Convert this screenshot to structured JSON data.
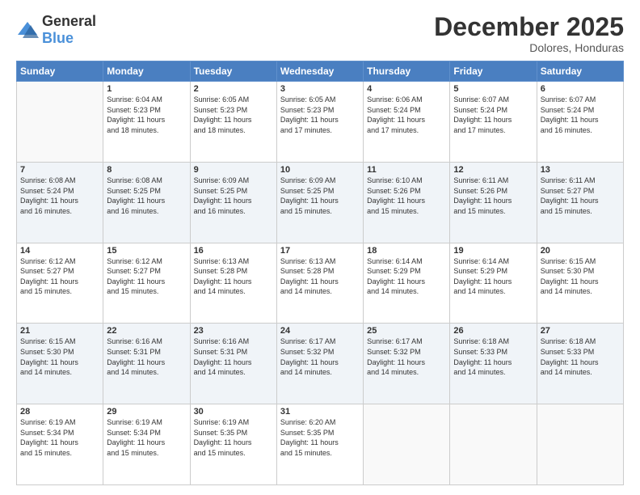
{
  "logo": {
    "general": "General",
    "blue": "Blue"
  },
  "header": {
    "month": "December 2025",
    "location": "Dolores, Honduras"
  },
  "weekdays": [
    "Sunday",
    "Monday",
    "Tuesday",
    "Wednesday",
    "Thursday",
    "Friday",
    "Saturday"
  ],
  "weeks": [
    [
      {
        "day": "",
        "info": ""
      },
      {
        "day": "1",
        "info": "Sunrise: 6:04 AM\nSunset: 5:23 PM\nDaylight: 11 hours\nand 18 minutes."
      },
      {
        "day": "2",
        "info": "Sunrise: 6:05 AM\nSunset: 5:23 PM\nDaylight: 11 hours\nand 18 minutes."
      },
      {
        "day": "3",
        "info": "Sunrise: 6:05 AM\nSunset: 5:23 PM\nDaylight: 11 hours\nand 17 minutes."
      },
      {
        "day": "4",
        "info": "Sunrise: 6:06 AM\nSunset: 5:24 PM\nDaylight: 11 hours\nand 17 minutes."
      },
      {
        "day": "5",
        "info": "Sunrise: 6:07 AM\nSunset: 5:24 PM\nDaylight: 11 hours\nand 17 minutes."
      },
      {
        "day": "6",
        "info": "Sunrise: 6:07 AM\nSunset: 5:24 PM\nDaylight: 11 hours\nand 16 minutes."
      }
    ],
    [
      {
        "day": "7",
        "info": "Sunrise: 6:08 AM\nSunset: 5:24 PM\nDaylight: 11 hours\nand 16 minutes."
      },
      {
        "day": "8",
        "info": "Sunrise: 6:08 AM\nSunset: 5:25 PM\nDaylight: 11 hours\nand 16 minutes."
      },
      {
        "day": "9",
        "info": "Sunrise: 6:09 AM\nSunset: 5:25 PM\nDaylight: 11 hours\nand 16 minutes."
      },
      {
        "day": "10",
        "info": "Sunrise: 6:09 AM\nSunset: 5:25 PM\nDaylight: 11 hours\nand 15 minutes."
      },
      {
        "day": "11",
        "info": "Sunrise: 6:10 AM\nSunset: 5:26 PM\nDaylight: 11 hours\nand 15 minutes."
      },
      {
        "day": "12",
        "info": "Sunrise: 6:11 AM\nSunset: 5:26 PM\nDaylight: 11 hours\nand 15 minutes."
      },
      {
        "day": "13",
        "info": "Sunrise: 6:11 AM\nSunset: 5:27 PM\nDaylight: 11 hours\nand 15 minutes."
      }
    ],
    [
      {
        "day": "14",
        "info": "Sunrise: 6:12 AM\nSunset: 5:27 PM\nDaylight: 11 hours\nand 15 minutes."
      },
      {
        "day": "15",
        "info": "Sunrise: 6:12 AM\nSunset: 5:27 PM\nDaylight: 11 hours\nand 15 minutes."
      },
      {
        "day": "16",
        "info": "Sunrise: 6:13 AM\nSunset: 5:28 PM\nDaylight: 11 hours\nand 14 minutes."
      },
      {
        "day": "17",
        "info": "Sunrise: 6:13 AM\nSunset: 5:28 PM\nDaylight: 11 hours\nand 14 minutes."
      },
      {
        "day": "18",
        "info": "Sunrise: 6:14 AM\nSunset: 5:29 PM\nDaylight: 11 hours\nand 14 minutes."
      },
      {
        "day": "19",
        "info": "Sunrise: 6:14 AM\nSunset: 5:29 PM\nDaylight: 11 hours\nand 14 minutes."
      },
      {
        "day": "20",
        "info": "Sunrise: 6:15 AM\nSunset: 5:30 PM\nDaylight: 11 hours\nand 14 minutes."
      }
    ],
    [
      {
        "day": "21",
        "info": "Sunrise: 6:15 AM\nSunset: 5:30 PM\nDaylight: 11 hours\nand 14 minutes."
      },
      {
        "day": "22",
        "info": "Sunrise: 6:16 AM\nSunset: 5:31 PM\nDaylight: 11 hours\nand 14 minutes."
      },
      {
        "day": "23",
        "info": "Sunrise: 6:16 AM\nSunset: 5:31 PM\nDaylight: 11 hours\nand 14 minutes."
      },
      {
        "day": "24",
        "info": "Sunrise: 6:17 AM\nSunset: 5:32 PM\nDaylight: 11 hours\nand 14 minutes."
      },
      {
        "day": "25",
        "info": "Sunrise: 6:17 AM\nSunset: 5:32 PM\nDaylight: 11 hours\nand 14 minutes."
      },
      {
        "day": "26",
        "info": "Sunrise: 6:18 AM\nSunset: 5:33 PM\nDaylight: 11 hours\nand 14 minutes."
      },
      {
        "day": "27",
        "info": "Sunrise: 6:18 AM\nSunset: 5:33 PM\nDaylight: 11 hours\nand 14 minutes."
      }
    ],
    [
      {
        "day": "28",
        "info": "Sunrise: 6:19 AM\nSunset: 5:34 PM\nDaylight: 11 hours\nand 15 minutes."
      },
      {
        "day": "29",
        "info": "Sunrise: 6:19 AM\nSunset: 5:34 PM\nDaylight: 11 hours\nand 15 minutes."
      },
      {
        "day": "30",
        "info": "Sunrise: 6:19 AM\nSunset: 5:35 PM\nDaylight: 11 hours\nand 15 minutes."
      },
      {
        "day": "31",
        "info": "Sunrise: 6:20 AM\nSunset: 5:35 PM\nDaylight: 11 hours\nand 15 minutes."
      },
      {
        "day": "",
        "info": ""
      },
      {
        "day": "",
        "info": ""
      },
      {
        "day": "",
        "info": ""
      }
    ]
  ]
}
